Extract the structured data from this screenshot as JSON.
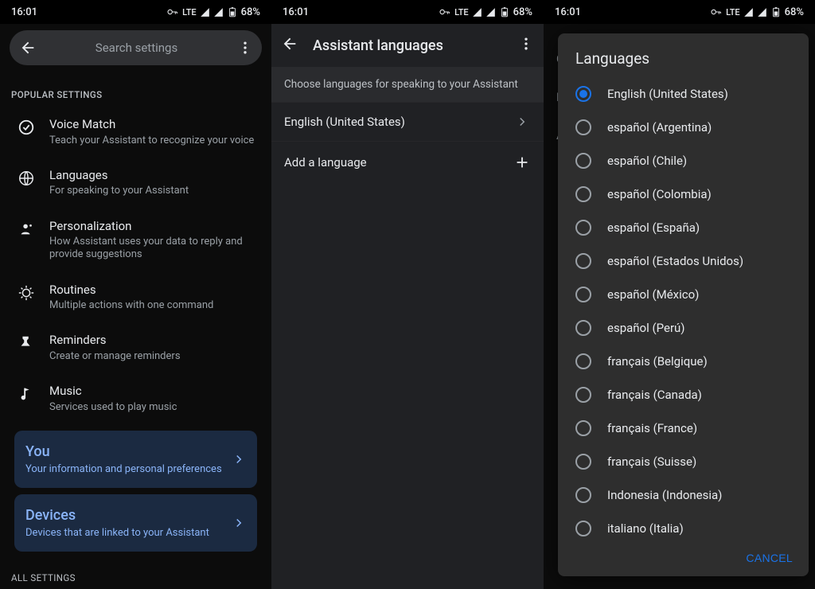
{
  "status": {
    "time": "16:01",
    "net_label": "LTE",
    "battery_pct": "68%"
  },
  "panel1": {
    "search_placeholder": "Search settings",
    "popular_header": "POPULAR SETTINGS",
    "all_settings_header": "ALL SETTINGS",
    "items": [
      {
        "title": "Voice Match",
        "sub": "Teach your Assistant to recognize your voice"
      },
      {
        "title": "Languages",
        "sub": "For speaking to your Assistant"
      },
      {
        "title": "Personalization",
        "sub": "How Assistant uses your data to reply and provide suggestions"
      },
      {
        "title": "Routines",
        "sub": "Multiple actions with one command"
      },
      {
        "title": "Reminders",
        "sub": "Create or manage reminders"
      },
      {
        "title": "Music",
        "sub": "Services used to play music"
      }
    ],
    "cards": [
      {
        "title": "You",
        "sub": "Your information and personal preferences"
      },
      {
        "title": "Devices",
        "sub": "Devices that are linked to your Assistant"
      }
    ]
  },
  "panel2": {
    "title": "Assistant languages",
    "banner": "Choose languages for speaking to your Assistant",
    "current_lang": "English (United States)",
    "add_label": "Add a language"
  },
  "panel3": {
    "dim1": "C",
    "dim2": "E",
    "dim3": "A",
    "dialog_title": "Languages",
    "cancel": "CANCEL",
    "options": [
      {
        "label": "English (United States)",
        "selected": true
      },
      {
        "label": "español (Argentina)",
        "selected": false
      },
      {
        "label": "español (Chile)",
        "selected": false
      },
      {
        "label": "español (Colombia)",
        "selected": false
      },
      {
        "label": "español (España)",
        "selected": false
      },
      {
        "label": "español (Estados Unidos)",
        "selected": false
      },
      {
        "label": "español (México)",
        "selected": false
      },
      {
        "label": "español (Perú)",
        "selected": false
      },
      {
        "label": "français (Belgique)",
        "selected": false
      },
      {
        "label": "français (Canada)",
        "selected": false
      },
      {
        "label": "français (France)",
        "selected": false
      },
      {
        "label": "français (Suisse)",
        "selected": false
      },
      {
        "label": "Indonesia (Indonesia)",
        "selected": false
      },
      {
        "label": "italiano (Italia)",
        "selected": false
      }
    ]
  }
}
